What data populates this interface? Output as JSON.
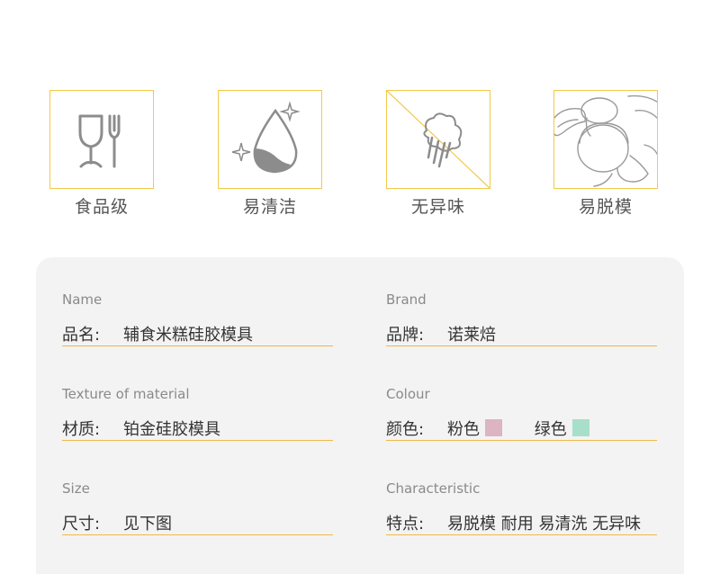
{
  "features": [
    {
      "label": "食品级",
      "icon": "food-grade-icon"
    },
    {
      "label": "易清洁",
      "icon": "water-drop-icon"
    },
    {
      "label": "无异味",
      "icon": "no-odor-icon"
    },
    {
      "label": "易脱模",
      "icon": "mold-release-icon"
    }
  ],
  "specs": {
    "name": {
      "en": "Name",
      "key": "品名:",
      "value": "辅食米糕硅胶模具"
    },
    "brand": {
      "en": "Brand",
      "key": "品牌:",
      "value": "诺莱焙"
    },
    "material": {
      "en": "Texture of material",
      "key": "材质:",
      "value": "铂金硅胶模具"
    },
    "colour": {
      "en": "Colour",
      "key": "颜色:",
      "options": [
        {
          "label": "粉色",
          "color": "#dcb4c2"
        },
        {
          "label": "绿色",
          "color": "#a8dfca"
        }
      ]
    },
    "size": {
      "en": "Size",
      "key": "尺寸:",
      "value": "见下图"
    },
    "characteristic": {
      "en": "Characteristic",
      "key": "特点:",
      "value": "易脱模 耐用 易清洗 无异味"
    }
  },
  "colors": {
    "accent": "#f2c94c",
    "panel": "#f3f3f3",
    "underline": "#f0b84a"
  }
}
